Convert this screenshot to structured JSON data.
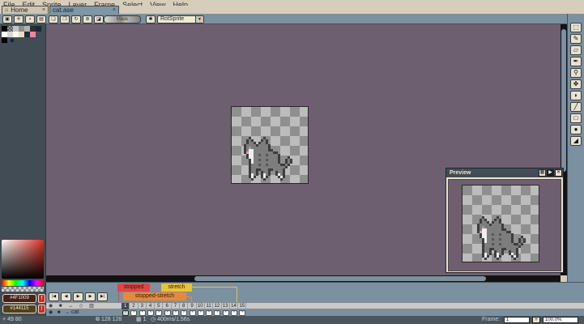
{
  "menu": {
    "items": [
      "File",
      "Edit",
      "Sprite",
      "Layer",
      "Frame",
      "Select",
      "View",
      "Help"
    ]
  },
  "tabs": {
    "home": {
      "label": "Home",
      "icon": "⌂",
      "close": "×"
    },
    "doc": {
      "label": "cat.ase",
      "close": "×"
    }
  },
  "context_bar": {
    "group1": [
      {
        "name": "pivot-button",
        "glyph": "▣"
      },
      {
        "name": "add-button",
        "glyph": "✛"
      },
      {
        "name": "square-button",
        "glyph": "▪"
      },
      {
        "name": "grid-button",
        "glyph": "▤"
      }
    ],
    "group2": [
      {
        "name": "copy-selection-button",
        "glyph": "❏"
      },
      {
        "name": "paste-selection-button",
        "glyph": "❐"
      },
      {
        "name": "rotate-button",
        "glyph": "↻"
      },
      {
        "name": "flip-button",
        "glyph": "⊛"
      },
      {
        "name": "corner-button",
        "glyph": "◪"
      }
    ],
    "mask_label": "Mask",
    "extra_button_glyph": "✱",
    "algorithm": "RotSprite",
    "dropdown_arrow": "▼"
  },
  "palette": {
    "row1": [
      "#000000",
      "checker",
      "#c4c4c4",
      "#8e8e8e",
      "#b2b2b2",
      "#2f2f2f",
      "#1f2733"
    ],
    "row2": [
      "#ffffff",
      "#d6d6d6",
      "#fdf8ec",
      "#eadfc0",
      "#202b3d",
      "#f283a5"
    ]
  },
  "color_editor": {
    "fg_hex": "#4F1009",
    "bg_hex": "#144115",
    "warning_glyph": "!"
  },
  "tools": [
    {
      "name": "rectangular-marquee-tool",
      "glyph": "⬚"
    },
    {
      "name": "pencil-tool",
      "glyph": "✎"
    },
    {
      "name": "eraser-tool",
      "glyph": "▱"
    },
    {
      "name": "eyedropper-tool",
      "glyph": "✒"
    },
    {
      "name": "zoom-tool",
      "glyph": "⚲"
    },
    {
      "name": "move-tool",
      "glyph": "✥"
    },
    {
      "name": "blur-tool",
      "glyph": "◗"
    },
    {
      "name": "line-tool",
      "glyph": "╱"
    },
    {
      "name": "rectangle-tool",
      "glyph": "□"
    },
    {
      "name": "contour-tool",
      "glyph": "●"
    },
    {
      "name": "jumble-tool",
      "glyph": "◢"
    }
  ],
  "preview": {
    "title": "Preview",
    "buttons": {
      "grid": "▦",
      "play": "▶",
      "close": "✕"
    }
  },
  "timeline": {
    "tags": [
      {
        "name": "stopped",
        "color": "#e04545"
      },
      {
        "name": "stretch",
        "color": "#e6c33c"
      },
      {
        "name": "stopped-stretch",
        "color": "#e68a3a"
      }
    ],
    "playback_buttons": [
      "|◀",
      "◀",
      "▶",
      "▶",
      "▶|"
    ],
    "header_icons": "◉ ■ ↔ ◇ ▥",
    "layer_icons": "◉ ■ ↔",
    "frames": [
      "1",
      "2",
      "3",
      "4",
      "5",
      "6",
      "7",
      "8",
      "9",
      "10",
      "11",
      "12",
      "13",
      "14",
      "15"
    ],
    "selected_frame": "1",
    "cell_dot": "•",
    "layer": {
      "name": "cat"
    }
  },
  "status": {
    "pos_icon": "+",
    "position": "49 80",
    "size_icon": "⧉",
    "size": "128 128",
    "frames_icon": "▦",
    "frames_count": "1",
    "time_icon": "◷",
    "timing": "400ms/1.56s",
    "frame_label": "Frame:",
    "frame_value": "1",
    "plus_label": "+",
    "zoom_value": "100.0%"
  },
  "sprite": {
    "palette": {
      "K": "#3d3d3d",
      "G": "#7d7d7d",
      "D": "#575757",
      "L": "#9a9a9a",
      "W": "#efefef",
      "P": "#e89aa8"
    },
    "rows": [
      "..K.....K...........",
      ".KGK...KGK..........",
      ".KGGK.KGGK..........",
      "KGGGGKGGGGK.........",
      "KGLGGGGGGGK.........",
      "KGWWGGGGGGKK........",
      "KPWWGGGGGGGGKK......",
      ".KWWGGDGGDGGGGK.....",
      ".KWWGGGGGGGGGGK...K.",
      "..KWGGDGGDGGGGK..KGK",
      "..KWGGGGGGGGGGK..KGK",
      "..KGGGDGGDGGGGGKKGK.",
      "..KGGGGGGGGGGGGGGK..",
      "..KGGKKGGGKKGGGGK...",
      "..KGGK.KGGK..KGGK...",
      "..KWGK.KWGK..KWGK...",
      "..KWK..KWK....KWK...",
      "...K....K......K...."
    ]
  }
}
